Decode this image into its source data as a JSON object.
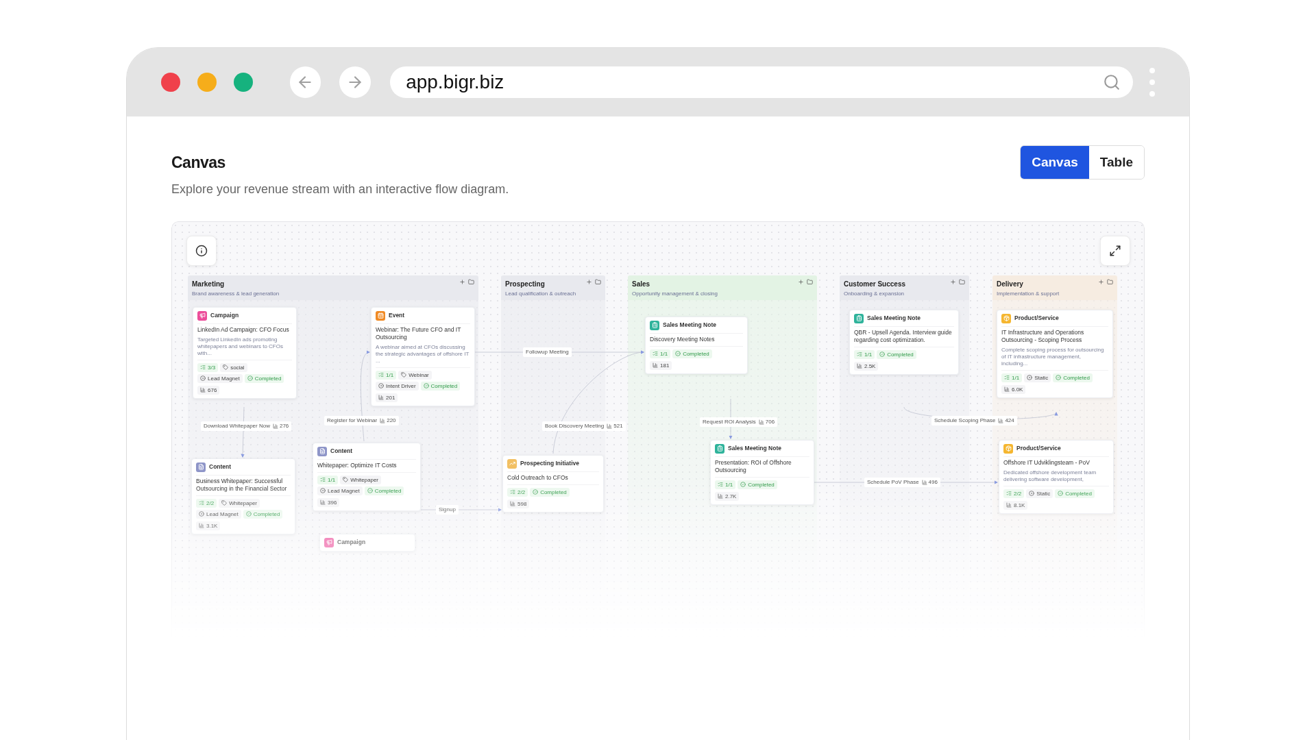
{
  "browser": {
    "url": "app.bigr.biz"
  },
  "page": {
    "title": "Canvas",
    "subtitle": "Explore your revenue stream with an interactive flow diagram."
  },
  "view_toggle": [
    {
      "label": "Canvas",
      "selected": true
    },
    {
      "label": "Table",
      "selected": false
    }
  ],
  "canvas": {
    "lanes": [
      {
        "title": "Marketing",
        "subtitle": "Brand awareness & lead generation",
        "color": "#e8e9ee"
      },
      {
        "title": "Prospecting",
        "subtitle": "Lead qualification & outreach",
        "color": "#e8e9ee"
      },
      {
        "title": "Sales",
        "subtitle": "Opportunity management & closing",
        "color": "#e3f3e4"
      },
      {
        "title": "Customer Success",
        "subtitle": "Onboarding & expansion",
        "color": "#e8e9ee"
      },
      {
        "title": "Delivery",
        "subtitle": "Implementation & support",
        "color": "#f6ece1"
      }
    ],
    "nodes": [
      {
        "kind": "campaign",
        "type_label": "Campaign",
        "title": "LinkedIn Ad Campaign: CFO Focus",
        "description": "Targeted LinkedIn ads promoting whitepapers and webinars to CFOs with...",
        "progress": "3/3",
        "tags": [
          {
            "kind": "channel",
            "text": "social"
          },
          {
            "kind": "type",
            "text": "Lead Magnet"
          }
        ],
        "status": "Completed",
        "metric": "676"
      },
      {
        "kind": "event",
        "type_label": "Event",
        "title": "Webinar: The Future CFO and IT Outsourcing",
        "description": "A webinar aimed at CFOs discussing the strategic advantages of offshore IT ...",
        "progress": "1/1",
        "tags": [
          {
            "kind": "channel",
            "text": "Webinar"
          },
          {
            "kind": "type",
            "text": "Intent Driver"
          }
        ],
        "status": "Completed",
        "metric": "201"
      },
      {
        "kind": "content",
        "type_label": "Content",
        "title": "Business Whitepaper: Successful Outsourcing in the Financial Sector",
        "progress": "2/2",
        "tags": [
          {
            "kind": "channel",
            "text": "Whitepaper"
          },
          {
            "kind": "type",
            "text": "Lead Magnet"
          }
        ],
        "status": "Completed",
        "metric": "3.1K"
      },
      {
        "kind": "content",
        "type_label": "Content",
        "title": "Whitepaper: Optimize IT Costs",
        "progress": "1/1",
        "tags": [
          {
            "kind": "channel",
            "text": "Whitepaper"
          },
          {
            "kind": "type",
            "text": "Lead Magnet"
          }
        ],
        "status": "Completed",
        "metric": "396"
      },
      {
        "kind": "campaign",
        "type_label": "Campaign"
      },
      {
        "kind": "prospecting",
        "type_label": "Prospecting Initiative",
        "title": "Cold Outreach to CFOs",
        "progress": "2/2",
        "status": "Completed",
        "metric": "598"
      },
      {
        "kind": "sales_note",
        "type_label": "Sales Meeting Note",
        "title": "Discovery Meeting Notes",
        "progress": "1/1",
        "status": "Completed",
        "metric": "181"
      },
      {
        "kind": "sales_note",
        "type_label": "Sales Meeting Note",
        "title": "Presentation: ROI of Offshore Outsourcing",
        "progress": "1/1",
        "status": "Completed",
        "metric": "2.7K"
      },
      {
        "kind": "sales_note",
        "type_label": "Sales Meeting Note",
        "title": "QBR - Upsell Agenda. Interview guide regarding cost optimization.",
        "progress": "1/1",
        "status": "Completed",
        "metric": "2.5K"
      },
      {
        "kind": "product",
        "type_label": "Product/Service",
        "title": "IT Infrastructure and Operations Outsourcing - Scoping Process",
        "description": "Complete scoping process for outsourcing of IT infrastructure management, including...",
        "progress": "1/1",
        "tags": [
          {
            "kind": "type",
            "text": "Static"
          }
        ],
        "status": "Completed",
        "metric": "6.0K"
      },
      {
        "kind": "product",
        "type_label": "Product/Service",
        "title": "Offshore IT Udviklingsteam - PoV",
        "description": "Dedicated offshore development team delivering software development,",
        "progress": "2/2",
        "tags": [
          {
            "kind": "type",
            "text": "Static"
          }
        ],
        "status": "Completed",
        "metric": "8.1K"
      }
    ],
    "edges": [
      {
        "label": "Download Whitepaper Now",
        "count": "276"
      },
      {
        "label": "Register for Webinar",
        "count": "220"
      },
      {
        "label": "Signup"
      },
      {
        "label": "Followup Meeting"
      },
      {
        "label": "Book Discovery Meeting",
        "count": "521"
      },
      {
        "label": "Request ROI Analysis",
        "count": "706"
      },
      {
        "label": "Schedule Scoping Phase",
        "count": "424"
      },
      {
        "label": "Schedule PoV Phase",
        "count": "496"
      }
    ]
  }
}
